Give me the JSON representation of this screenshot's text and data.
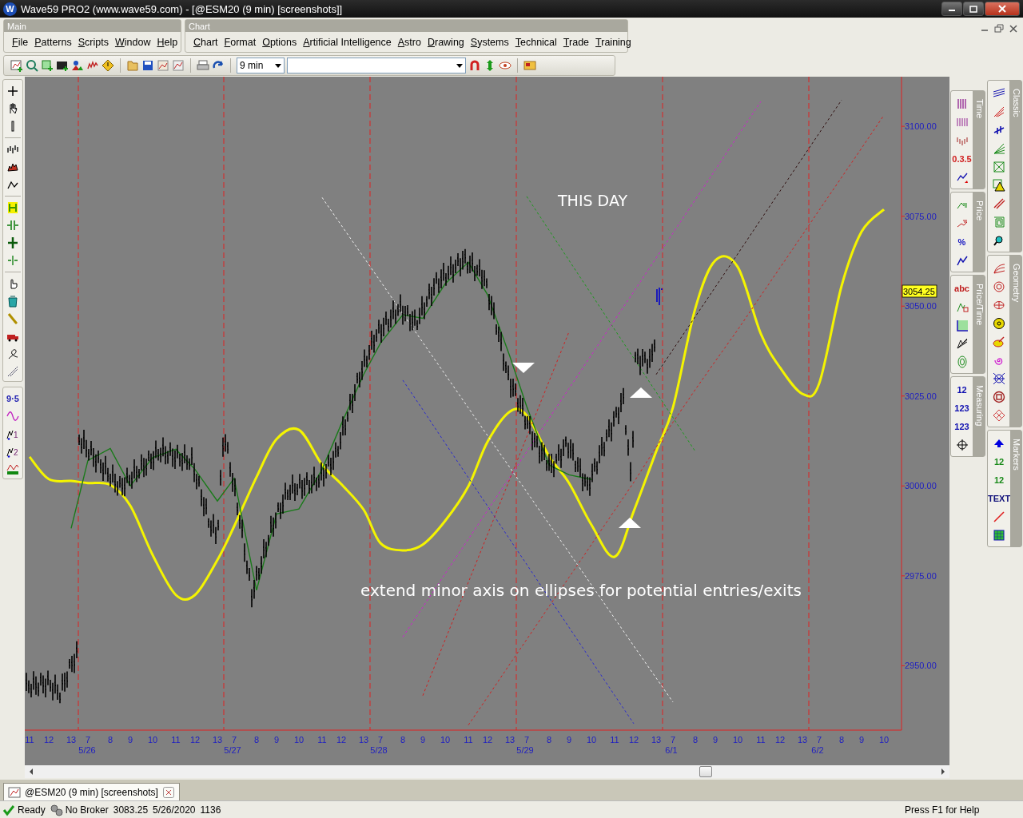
{
  "window": {
    "logo": "W",
    "title": "Wave59 PRO2 (www.wave59.com) - [@ESM20 (9 min) [screenshots]]"
  },
  "menubars": [
    {
      "title": "Main",
      "items": [
        "File",
        "Patterns",
        "Scripts",
        "Window",
        "Help"
      ]
    },
    {
      "title": "Chart",
      "items": [
        "Chart",
        "Format",
        "Options",
        "Artificial Intelligence",
        "Astro",
        "Drawing",
        "Systems",
        "Technical",
        "Trade",
        "Training"
      ]
    }
  ],
  "toolbar": {
    "interval": "9 min"
  },
  "left_tools": [
    {
      "items": [
        {
          "kind": "icon"
        },
        {
          "kind": "icon"
        },
        {
          "kind": "icon"
        }
      ]
    },
    {
      "items": [
        {
          "kind": "icon"
        },
        {
          "kind": "icon"
        },
        {
          "kind": "icon"
        }
      ]
    },
    {
      "items": [
        {
          "kind": "icon"
        },
        {
          "kind": "icon"
        },
        {
          "kind": "icon"
        },
        {
          "kind": "icon"
        }
      ]
    },
    {
      "items": [
        {
          "kind": "icon"
        },
        {
          "kind": "icon"
        },
        {
          "kind": "icon"
        },
        {
          "kind": "icon"
        },
        {
          "kind": "icon"
        },
        {
          "kind": "icon"
        }
      ]
    },
    {
      "items": [
        {
          "kind": "glyph",
          "text": "9·5"
        },
        {
          "kind": "icon"
        },
        {
          "kind": "wave",
          "text": "1"
        },
        {
          "kind": "wave",
          "text": "2"
        },
        {
          "kind": "icon"
        }
      ]
    }
  ],
  "chart": {
    "annotations": [
      "THIS DAY",
      "extend minor axis on ellipses for potential entries/exits"
    ],
    "chart_data": {
      "type": "line",
      "categories": [
        "11",
        "12",
        "13",
        "7",
        "8",
        "9",
        "10",
        "11",
        "12",
        "13",
        "7",
        "8",
        "9",
        "10",
        "11",
        "12",
        "13",
        "7",
        "8",
        "9",
        "10",
        "11",
        "12",
        "13",
        "7",
        "8",
        "9",
        "10",
        "11",
        "12",
        "13",
        "7",
        "8",
        "9",
        "10",
        "11",
        "12",
        "13",
        "7",
        "8",
        "9",
        "10"
      ],
      "ylim": [
        2932.1,
        3113.8
      ],
      "yticks": [
        {
          "value": 3100,
          "label": "3100.00"
        },
        {
          "value": 3075,
          "label": "3075.00"
        },
        {
          "value": 3050,
          "label": "3050.00"
        },
        {
          "value": 3025,
          "label": "3025.00"
        },
        {
          "value": 3000,
          "label": "3000.00"
        },
        {
          "value": 2975,
          "label": "2975.00"
        },
        {
          "value": 2950,
          "label": "2950.00"
        }
      ],
      "series": [
        {
          "color": "#f4f400",
          "values": [
            3008.1,
            3001.9,
            3001.4,
            3000.8,
            3000.3,
            2994.5,
            2980.8,
            2969.7,
            2969.7,
            2979.4,
            2988.8,
            3002.5,
            3013.0,
            3015.6,
            3005.9,
            3000.5,
            2993.4,
            2984.1,
            2982.1,
            2983.7,
            2990.3,
            2999.9,
            3012.3,
            3020.7,
            3019.6,
            3008.3,
            3000.8,
            2989.2,
            2980.3,
            2993.0,
            3009.6,
            3021.8,
            3049.4,
            3062.7,
            3060.9,
            3042.3,
            3032.9,
            3025.6,
            3028.5,
            3055.6,
            3070.7,
            3076.9
          ]
        },
        {
          "color": "#1a7a1a",
          "values": [
            null,
            null,
            2988.2,
            3007.1,
            3010.4,
            3000.0,
            3007.9,
            3010.2,
            3004.6,
            2995.8,
            3002.1,
            2971.0,
            2992.2,
            2993.6,
            3004.6,
            3017.2,
            3031.0,
            3039.7,
            3047.6,
            3046.6,
            3056.2,
            3062.2,
            3053.2,
            3036.0,
            3022.1,
            3005.8,
            3003.1,
            3001.8,
            null,
            null,
            null,
            null,
            null,
            null,
            null,
            null,
            null,
            null,
            null,
            null,
            null,
            null
          ]
        },
        {
          "color": "#f0f0f0",
          "line_style": "dashed",
          "values": [
            null,
            null,
            null,
            null,
            null,
            null,
            null,
            null,
            null,
            null,
            null,
            null,
            null,
            null,
            3080.2,
            3072.5,
            3063.6,
            3056.9,
            3047.9,
            3039.9,
            3031.0,
            3021.7,
            3014.0,
            3005.1,
            2998.4,
            2989.4,
            2981.5,
            2972.5,
            2963.2,
            2955.5,
            2946.6,
            2939.9,
            null,
            null,
            null,
            null,
            null,
            null,
            null,
            null,
            null,
            null
          ]
        },
        {
          "color": "#2a2ad0",
          "line_style": "dashed",
          "values": [
            null,
            null,
            null,
            null,
            null,
            null,
            null,
            null,
            null,
            null,
            null,
            null,
            null,
            null,
            null,
            null,
            null,
            null,
            3029.4,
            3021.2,
            3011.9,
            3002.3,
            2994.4,
            2985.1,
            2978.2,
            2968.9,
            2960.7,
            2951.4,
            2941.8,
            2933.9,
            null,
            null,
            null,
            null,
            null,
            null,
            null,
            null,
            null,
            null,
            null,
            null
          ]
        },
        {
          "color": "#1a9a1a",
          "line_style": "dashed",
          "values": [
            null,
            null,
            null,
            null,
            null,
            null,
            null,
            null,
            null,
            null,
            null,
            null,
            null,
            null,
            null,
            null,
            null,
            null,
            null,
            null,
            null,
            null,
            null,
            null,
            3080.5,
            3071.1,
            3062.7,
            3053.3,
            3043.5,
            3035.5,
            3026.1,
            3019.0,
            3009.6,
            null,
            null,
            null,
            null,
            null,
            null,
            null,
            null,
            null
          ]
        },
        {
          "color": "#d020d0",
          "line_style": "dashed",
          "values": [
            null,
            null,
            null,
            null,
            null,
            null,
            null,
            null,
            null,
            null,
            null,
            null,
            null,
            null,
            null,
            null,
            null,
            null,
            2958.0,
            2966.3,
            2975.6,
            2985.2,
            2993.2,
            3002.5,
            3009.5,
            3018.8,
            3027.1,
            3036.4,
            3046.1,
            3054.0,
            3063.4,
            3070.3,
            3079.6,
            3087.9,
            3097.3,
            3106.9,
            null,
            null,
            null,
            null,
            null,
            null
          ]
        },
        {
          "color": "#d02020",
          "line_style": "dashed",
          "values": [
            null,
            null,
            null,
            null,
            null,
            null,
            null,
            null,
            null,
            null,
            null,
            null,
            null,
            null,
            null,
            null,
            null,
            null,
            null,
            2941.7,
            2957.2,
            2973.2,
            2986.5,
            3002.0,
            3013.6,
            3029.1,
            3042.9,
            null,
            null,
            null,
            null,
            null,
            null,
            null,
            null,
            null,
            null,
            null,
            null,
            null,
            null,
            null
          ]
        },
        {
          "color": "#d02020",
          "line_style": "dashed",
          "values": [
            null,
            null,
            null,
            null,
            null,
            null,
            null,
            null,
            null,
            null,
            null,
            null,
            null,
            null,
            null,
            null,
            null,
            null,
            null,
            null,
            null,
            2933.5,
            2941.3,
            2950.5,
            2957.3,
            2966.5,
            2974.6,
            2983.7,
            2993.2,
            3001.0,
            3010.8,
            3017.7,
            3026.8,
            3034.7,
            3043.4,
            3052.9,
            3060.7,
            3069.8,
            3076.7,
            3085.8,
            3093.9,
            3103.1
          ]
        },
        {
          "color": "#301010",
          "line_style": "dashed",
          "values": [
            null,
            null,
            null,
            null,
            null,
            null,
            null,
            null,
            null,
            null,
            null,
            null,
            null,
            null,
            null,
            null,
            null,
            null,
            null,
            null,
            null,
            null,
            null,
            null,
            null,
            null,
            null,
            null,
            null,
            null,
            3031.0,
            3037.9,
            3047.1,
            3055.3,
            3064.5,
            3074.1,
            3082.0,
            3091.2,
            3098.1,
            3107.3,
            null,
            null
          ]
        }
      ]
    },
    "last_price": "3054.25",
    "date_labels": [
      "5/26",
      "5/27",
      "5/28",
      "5/29",
      "6/1",
      "6/2"
    ]
  },
  "right_panels": [
    {
      "title": "Time",
      "items": [
        {
          "kind": "icon"
        },
        {
          "kind": "icon"
        },
        {
          "kind": "icon"
        },
        {
          "kind": "glyph",
          "text": "0.3.5"
        },
        {
          "kind": "icon"
        }
      ]
    },
    {
      "title": "Price",
      "items": [
        {
          "kind": "icon"
        },
        {
          "kind": "icon"
        },
        {
          "kind": "glyph",
          "text": "%"
        },
        {
          "kind": "icon"
        }
      ]
    },
    {
      "title": "Price/Time",
      "items": [
        {
          "kind": "glyph",
          "text": "abc"
        },
        {
          "kind": "icon"
        },
        {
          "kind": "icon"
        },
        {
          "kind": "icon"
        },
        {
          "kind": "icon"
        }
      ]
    },
    {
      "title": "Measuring",
      "items": [
        {
          "kind": "glyph",
          "text": "12"
        },
        {
          "kind": "glyph",
          "text": "123"
        },
        {
          "kind": "glyph",
          "text": "123"
        },
        {
          "kind": "icon"
        }
      ]
    },
    {
      "title": "Classic",
      "items": [
        {
          "kind": "icon"
        },
        {
          "kind": "icon"
        },
        {
          "kind": "icon"
        },
        {
          "kind": "icon"
        },
        {
          "kind": "icon"
        },
        {
          "kind": "icon"
        },
        {
          "kind": "icon"
        },
        {
          "kind": "icon"
        },
        {
          "kind": "icon"
        }
      ]
    },
    {
      "title": "Geometry",
      "items": [
        {
          "kind": "icon"
        },
        {
          "kind": "icon"
        },
        {
          "kind": "icon"
        },
        {
          "kind": "icon"
        },
        {
          "kind": "icon"
        },
        {
          "kind": "icon"
        },
        {
          "kind": "icon"
        },
        {
          "kind": "icon"
        },
        {
          "kind": "icon"
        }
      ]
    },
    {
      "title": "Markers",
      "items": [
        {
          "kind": "icon"
        },
        {
          "kind": "glyph",
          "text": "12"
        },
        {
          "kind": "glyph",
          "text": "12"
        },
        {
          "kind": "glyph",
          "text": "TEXT"
        },
        {
          "kind": "icon"
        },
        {
          "kind": "icon"
        }
      ]
    }
  ],
  "tabs": [
    {
      "label": "@ESM20 (9 min) [screenshots]",
      "selected": true
    }
  ],
  "status_bar": {
    "ready": "Ready",
    "broker": "No Broker",
    "price": "3083.25",
    "date": "5/26/2020",
    "time": "1136",
    "help": "Press F1 for Help"
  }
}
